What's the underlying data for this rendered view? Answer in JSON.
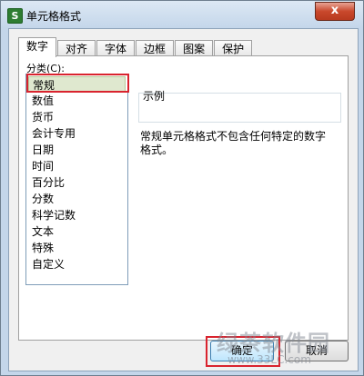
{
  "window": {
    "app_icon": "S",
    "title": "单元格格式",
    "close_glyph": "x"
  },
  "tabs": [
    {
      "label": "数字",
      "active": true
    },
    {
      "label": "对齐"
    },
    {
      "label": "字体"
    },
    {
      "label": "边框"
    },
    {
      "label": "图案"
    },
    {
      "label": "保护"
    }
  ],
  "category": {
    "label": "分类(C):",
    "selected": "常规",
    "items": [
      "常规",
      "数值",
      "货币",
      "会计专用",
      "日期",
      "时间",
      "百分比",
      "分数",
      "科学记数",
      "文本",
      "特殊",
      "自定义"
    ]
  },
  "sample": {
    "legend": "示例"
  },
  "description": {
    "line1": "常规单元格格式不包含任何特定的数字",
    "line2": "格式。"
  },
  "buttons": {
    "ok": "确定",
    "cancel": "取消"
  },
  "watermark": {
    "main": "绿茶软件园",
    "sub": "www.33LC.com"
  },
  "colors": {
    "highlight_outline": "#d9232e",
    "selected_item_bg": "#dfe8cf",
    "title_bar": "#c4d6ea"
  }
}
